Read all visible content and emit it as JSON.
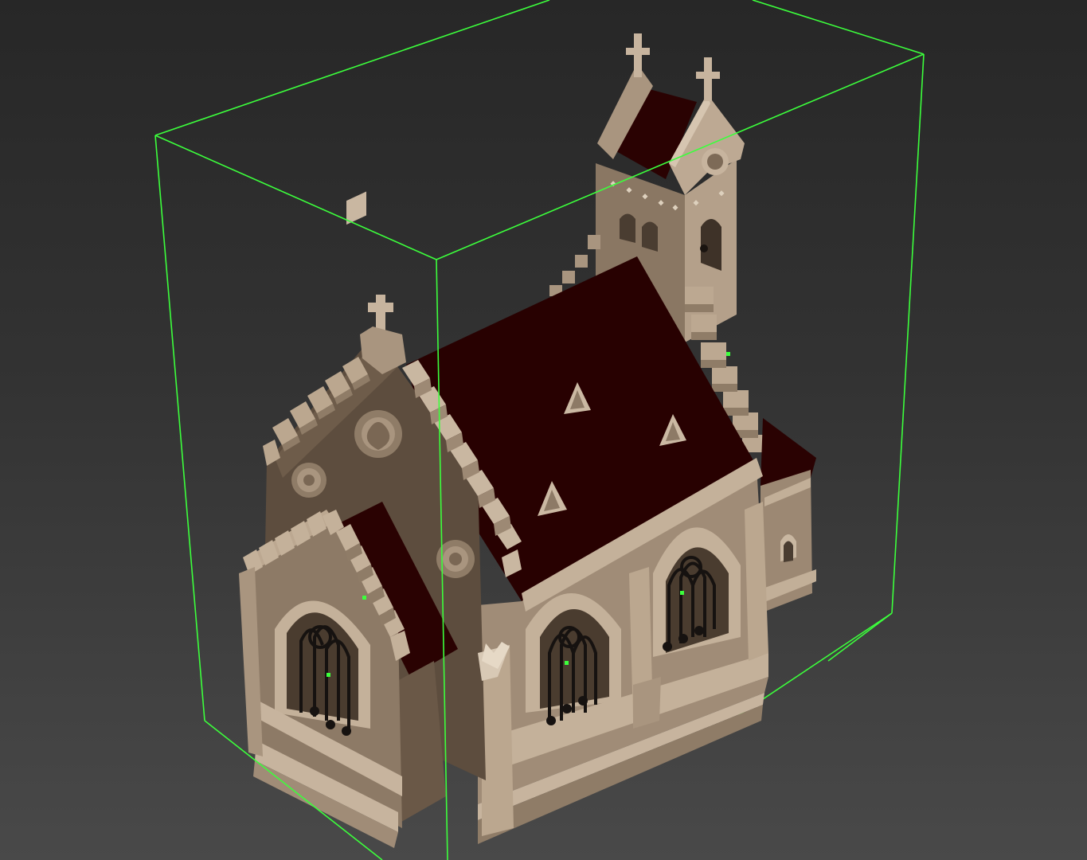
{
  "viewport": {
    "view": "perspective",
    "background": [
      "#272727",
      "#494949"
    ],
    "selection_color": "#3cff3c"
  },
  "scene": {
    "object": "church",
    "selected": true,
    "colors": {
      "stone_light": "#bba890",
      "stone_mid": "#8f7c67",
      "stone_dark": "#5e4f40",
      "stone_shadow": "#4b3e32",
      "roof": "#2a0202",
      "window_tracery": "#161210"
    }
  }
}
